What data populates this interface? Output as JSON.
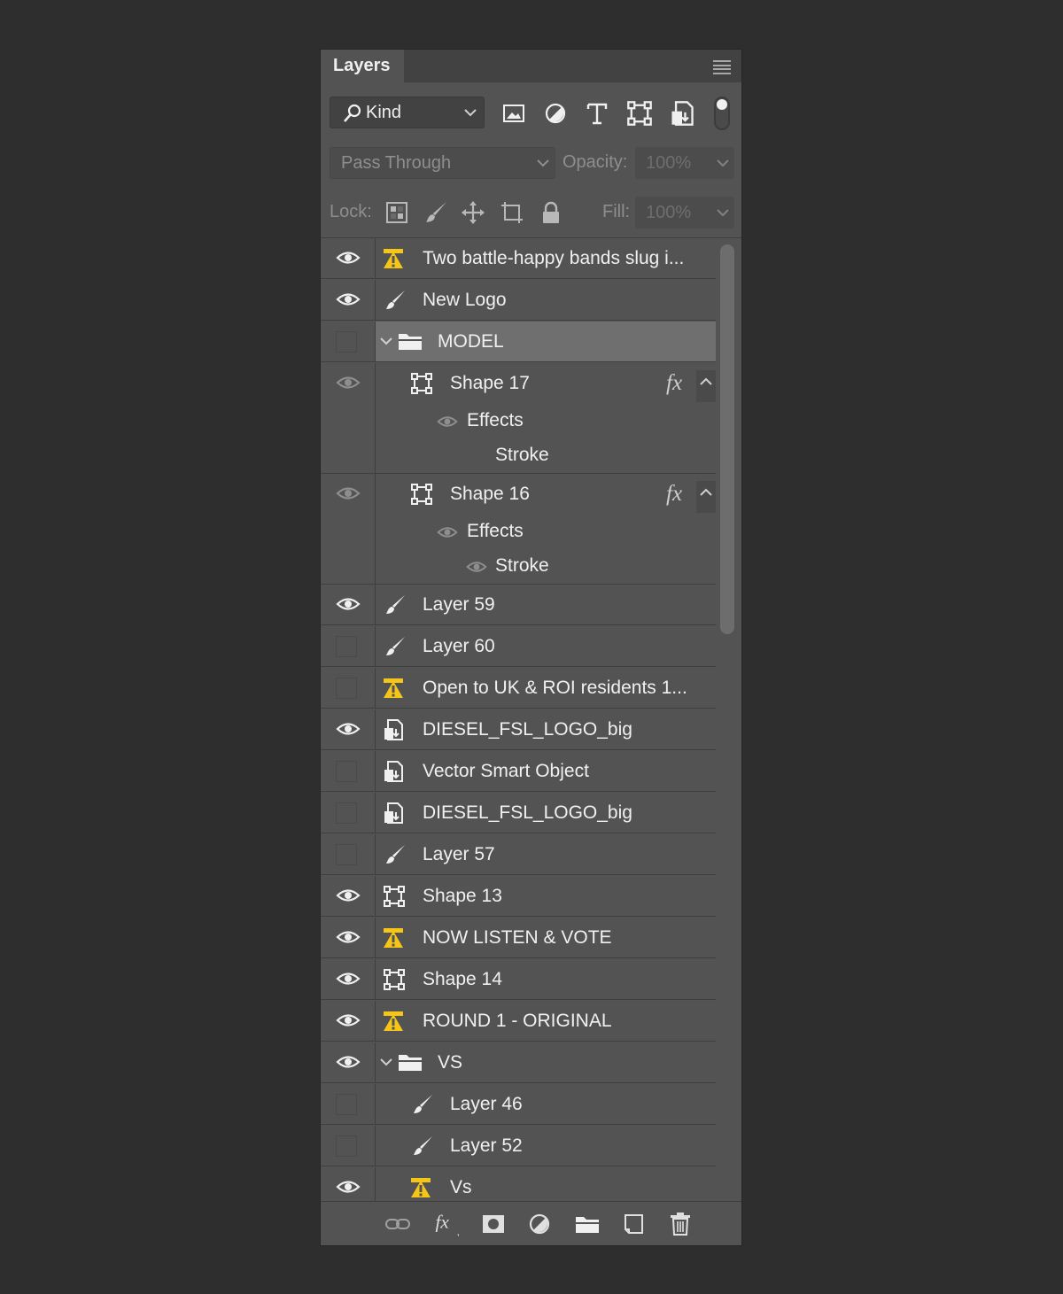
{
  "panel": {
    "tab_label": "Layers"
  },
  "filter": {
    "kind_label": "Kind"
  },
  "blend": {
    "mode": "Pass Through",
    "opacity_label": "Opacity:",
    "opacity_value": "100%"
  },
  "lock": {
    "label": "Lock:",
    "fill_label": "Fill:",
    "fill_value": "100%"
  },
  "colors": {
    "warning": "#f5c518",
    "panel_bg": "#535353",
    "selected_row": "#6f6f6f"
  },
  "layers": [
    {
      "name": "Two battle-happy bands slug i...",
      "type": "text-warning",
      "visible": true
    },
    {
      "name": "New Logo",
      "type": "paint",
      "visible": true
    },
    {
      "name": "MODEL",
      "type": "group",
      "visible": false,
      "selected": true
    },
    {
      "name": "Shape 17",
      "type": "shape",
      "visible": "dim",
      "fx": "fx",
      "effects_label": "Effects",
      "stroke_label": "Stroke"
    },
    {
      "name": "Shape 16",
      "type": "shape",
      "visible": "dim",
      "fx": "fx",
      "effects_label": "Effects",
      "stroke_label": "Stroke"
    },
    {
      "name": "Layer 59",
      "type": "paint",
      "visible": true
    },
    {
      "name": "Layer 60",
      "type": "paint",
      "visible": false
    },
    {
      "name": "Open to UK & ROI residents 1...",
      "type": "text-warning",
      "visible": false
    },
    {
      "name": "DIESEL_FSL_LOGO_big",
      "type": "smart",
      "visible": true
    },
    {
      "name": "Vector Smart Object",
      "type": "smart",
      "visible": false
    },
    {
      "name": "DIESEL_FSL_LOGO_big",
      "type": "smart",
      "visible": false
    },
    {
      "name": "Layer 57",
      "type": "paint",
      "visible": false
    },
    {
      "name": "Shape 13",
      "type": "shape",
      "visible": true
    },
    {
      "name": "NOW LISTEN & VOTE",
      "type": "text-warning",
      "visible": true
    },
    {
      "name": "Shape 14",
      "type": "shape",
      "visible": true
    },
    {
      "name": "ROUND 1 - ORIGINAL",
      "type": "text-warning",
      "visible": true
    },
    {
      "name": "VS",
      "type": "group",
      "visible": true
    },
    {
      "name": "Layer 46",
      "type": "paint",
      "visible": false
    },
    {
      "name": "Layer 52",
      "type": "paint",
      "visible": false
    },
    {
      "name": "Vs",
      "type": "text-warning",
      "visible": true
    }
  ],
  "footer_icons": [
    "link-icon",
    "fx-icon",
    "mask-icon",
    "adjustment-icon",
    "folder-icon",
    "new-layer-icon",
    "trash-icon"
  ]
}
